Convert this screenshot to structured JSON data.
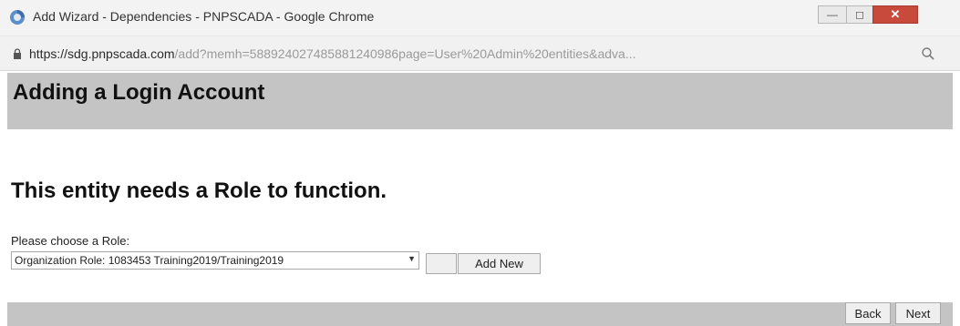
{
  "window": {
    "title": "Add Wizard - Dependencies - PNPSCADA - Google Chrome"
  },
  "address": {
    "host": "https://sdg.pnpscada.com",
    "path": "/add?memh=588924027485881240986page=User%20Admin%20entities&adva..."
  },
  "page": {
    "title": "Adding a Login Account",
    "subheading": "This entity needs a Role to function.",
    "choose_label": "Please choose a Role:",
    "role_selected": "Organization Role: 1083453 Training2019/Training2019",
    "add_new_label": "Add New",
    "back_label": "Back",
    "next_label": "Next"
  },
  "colors": {
    "header_bg": "#c4c4c4",
    "close_button": "#c84a3c"
  },
  "icons": {
    "app": "chrome-app-icon",
    "lock": "lock-icon",
    "zoom": "zoom-icon"
  }
}
